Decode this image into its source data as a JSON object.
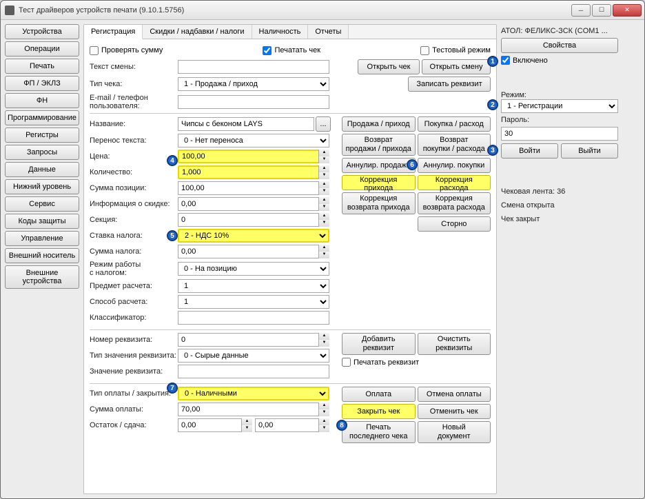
{
  "title": "Тест драйверов устройств печати (9.10.1.5756)",
  "sidebar": {
    "items": [
      "Устройства",
      "Операции",
      "Печать",
      "ФП / ЭКЛЗ",
      "ФН",
      "Программирование",
      "Регистры",
      "Запросы",
      "Данные",
      "Нижний уровень",
      "Сервис",
      "Коды защиты",
      "Управление",
      "Внешний носитель",
      "Внешние\nустройства"
    ]
  },
  "tabs": [
    "Регистрация",
    "Скидки / надбавки / налоги",
    "Наличность",
    "Отчеты"
  ],
  "topchecks": {
    "verify_sum": "Проверять сумму",
    "print_check": "Печатать чек",
    "test_mode": "Тестовый режим"
  },
  "labels": {
    "shift_text": "Текст смены:",
    "check_type": "Тип чека:",
    "email_phone": "E-mail / телефон\nпользователя:",
    "name": "Название:",
    "text_wrap": "Перенос текста:",
    "price": "Цена:",
    "qty": "Количество:",
    "position_sum": "Сумма позиции:",
    "discount_info": "Информация о скидке:",
    "section": "Секция:",
    "tax_rate": "Ставка налога:",
    "tax_sum": "Сумма налога:",
    "tax_mode": "Режим работы\nс налогом:",
    "calc_subject": "Предмет расчета:",
    "calc_method": "Способ расчета:",
    "classifier": "Классификатор:",
    "req_num": "Номер реквизита:",
    "req_val_type": "Тип значения реквизита:",
    "req_val": "Значение реквизита:",
    "print_req": "Печатать реквизит",
    "pay_close_type": "Тип оплаты / закрытия:",
    "pay_sum": "Сумма оплаты:",
    "remainder": "Остаток / сдача:"
  },
  "values": {
    "check_type": "1 - Продажа / приход",
    "name": "Чипсы с беконом LAYS",
    "text_wrap": "0 - Нет переноса",
    "price": "100,00",
    "qty": "1,000",
    "position_sum": "100,00",
    "discount_info": "0,00",
    "section": "0",
    "tax_rate": "2 - НДС 10%",
    "tax_sum": "0,00",
    "tax_mode": "0 - На позицию",
    "calc_subject": "1",
    "calc_method": "1",
    "classifier": "",
    "req_num": "0",
    "req_val_type": "0 - Сырые данные",
    "req_val": "",
    "pay_close_type": "0 - Наличными",
    "pay_sum": "70,00",
    "remainder1": "0,00",
    "remainder2": "0,00"
  },
  "buttons": {
    "open_check": "Открыть чек",
    "open_shift": "Открыть смену",
    "write_req": "Записать реквизит",
    "sale_income": "Продажа / приход",
    "buy_expense": "Покупка / расход",
    "ret_sale": "Возврат\nпродажи / прихода",
    "ret_buy": "Возврат\nпокупки / расхода",
    "annul_sale": "Аннулир. продажи",
    "annul_buy": "Аннулир. покупки",
    "corr_income": "Коррекция прихода",
    "corr_expense": "Коррекция расхода",
    "corr_ret_income": "Коррекция\nвозврата прихода",
    "corr_ret_expense": "Коррекция\nвозврата расхода",
    "storno": "Сторно",
    "add_req": "Добавить\nреквизит",
    "clear_req": "Очистить\nреквизиты",
    "payment": "Оплата",
    "cancel_payment": "Отмена оплаты",
    "close_check": "Закрыть чек",
    "cancel_check": "Отменить чек",
    "print_last": "Печать\nпоследнего чека",
    "new_doc": "Новый\nдокумент",
    "dots": "..."
  },
  "right": {
    "device": "АТОЛ: ФЕЛИКС-ЗСК (COM1 ...",
    "properties": "Свойства",
    "enabled": "Включено",
    "mode": "Режим:",
    "mode_val": "1 - Регистрации",
    "password": "Пароль:",
    "password_val": "30",
    "login": "Войти",
    "logout": "Выйти",
    "status1": "Чековая лента: 36",
    "status2": "Смена открыта",
    "status3": "Чек закрыт"
  },
  "markers": [
    "1",
    "2",
    "3",
    "4",
    "5",
    "6",
    "7",
    "8"
  ]
}
